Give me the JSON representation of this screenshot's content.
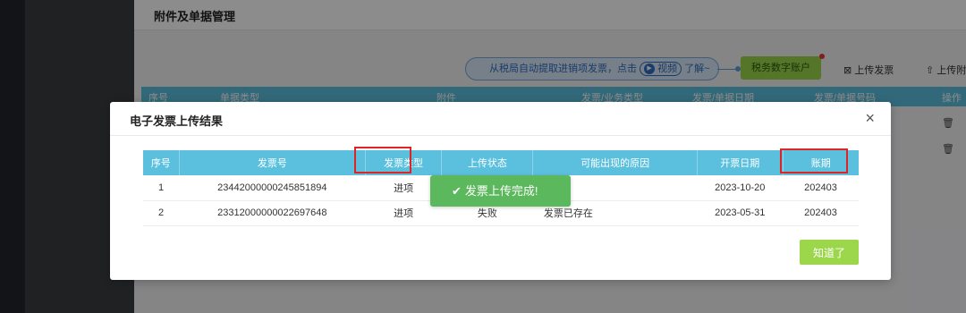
{
  "page": {
    "title": "附件及单据管理"
  },
  "banner": {
    "prefix": "从税局自动提取进销项发票，点击",
    "video_label": "视频",
    "suffix": "了解~"
  },
  "toolbar": {
    "tax_account_label": "税务数字账户",
    "upload_invoice_label": "上传发票",
    "upload_attach_label": "上传附"
  },
  "bg_table": {
    "columns": [
      "序号",
      "单据类型",
      "附件",
      "发票/业务类型",
      "发票/单据日期",
      "发票/单据号码",
      "操作"
    ]
  },
  "modal": {
    "title": "电子发票上传结果",
    "columns": [
      "序号",
      "发票号",
      "发票类型",
      "上传状态",
      "可能出现的原因",
      "开票日期",
      "账期"
    ],
    "rows": [
      [
        "1",
        "23442000000245851894",
        "进项",
        "",
        "在",
        "2023-10-20",
        "202403"
      ],
      [
        "2",
        "23312000000022697648",
        "进项",
        "失败",
        "发票已存在",
        "2023-05-31",
        "202403"
      ]
    ],
    "ok_label": "知道了"
  },
  "toast": {
    "message": "发票上传完成!"
  }
}
